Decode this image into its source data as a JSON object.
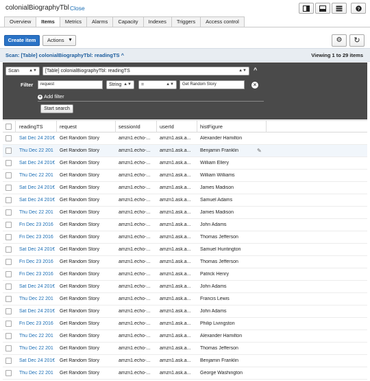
{
  "window": {
    "title": "colonialBiographyTbl",
    "close_label": "Close"
  },
  "view_buttons": [
    "panel-right-icon",
    "panel-bottom-icon",
    "panel-full-icon",
    "help-icon"
  ],
  "tabs": [
    {
      "label": "Overview",
      "active": false
    },
    {
      "label": "Items",
      "active": true
    },
    {
      "label": "Metrics",
      "active": false
    },
    {
      "label": "Alarms",
      "active": false
    },
    {
      "label": "Capacity",
      "active": false
    },
    {
      "label": "Indexes",
      "active": false
    },
    {
      "label": "Triggers",
      "active": false
    },
    {
      "label": "Access control",
      "active": false
    }
  ],
  "toolbar": {
    "create_label": "Create item",
    "actions_label": "Actions",
    "gear_icon": "gear-icon",
    "refresh_icon": "refresh-icon"
  },
  "scan": {
    "label": "Scan: [Table] colonialBiographyTbl: readingTS ^",
    "viewing": "Viewing 1 to 29 items"
  },
  "filter_panel": {
    "mode": "Scan",
    "target": "[Table] colonialBiographyTbl: readingTS",
    "filter_label": "Filter",
    "attribute": "request",
    "type": "String",
    "operator": "=",
    "value": "Get Random Story",
    "add_filter_label": "Add filter",
    "start_search_label": "Start search"
  },
  "table": {
    "columns": [
      "readingTS",
      "request",
      "sessionId",
      "userId",
      "histFigure"
    ],
    "rows": [
      [
        "Sat Dec 24 201€",
        "Get Random Story",
        "amzn1.echo-...",
        "amzn1.ask.a...",
        "Alexander Hamilton"
      ],
      [
        "Thu Dec 22 201",
        "Get Random Story",
        "amzn1.echo-...",
        "amzn1.ask.a...",
        "Benjamin Franklin"
      ],
      [
        "Sat Dec 24 201€",
        "Get Random Story",
        "amzn1.echo-...",
        "amzn1.ask.a...",
        "William Ellery"
      ],
      [
        "Thu Dec 22 201",
        "Get Random Story",
        "amzn1.echo-...",
        "amzn1.ask.a...",
        "William Williams"
      ],
      [
        "Sat Dec 24 201€",
        "Get Random Story",
        "amzn1.echo-...",
        "amzn1.ask.a...",
        "James Madison"
      ],
      [
        "Sat Dec 24 201€",
        "Get Random Story",
        "amzn1.echo-...",
        "amzn1.ask.a...",
        "Samuel Adams"
      ],
      [
        "Thu Dec 22 201",
        "Get Random Story",
        "amzn1.echo-...",
        "amzn1.ask.a...",
        "James Madison"
      ],
      [
        "Fri Dec 23 2016",
        "Get Random Story",
        "amzn1.echo-...",
        "amzn1.ask.a...",
        "John Adams"
      ],
      [
        "Fri Dec 23 2016",
        "Get Random Story",
        "amzn1.echo-...",
        "amzn1.ask.a...",
        "Thomas Jefferson"
      ],
      [
        "Sat Dec 24 201€",
        "Get Random Story",
        "amzn1.echo-...",
        "amzn1.ask.a...",
        "Samuel Huntington"
      ],
      [
        "Fri Dec 23 2016",
        "Get Random Story",
        "amzn1.echo-...",
        "amzn1.ask.a...",
        "Thomas Jefferson"
      ],
      [
        "Fri Dec 23 2016",
        "Get Random Story",
        "amzn1.echo-...",
        "amzn1.ask.a...",
        "Patrick Henry"
      ],
      [
        "Sat Dec 24 201€",
        "Get Random Story",
        "amzn1.echo-...",
        "amzn1.ask.a...",
        "John Adams"
      ],
      [
        "Thu Dec 22 201",
        "Get Random Story",
        "amzn1.echo-...",
        "amzn1.ask.a...",
        "Francis Lewis"
      ],
      [
        "Sat Dec 24 201€",
        "Get Random Story",
        "amzn1.echo-...",
        "amzn1.ask.a...",
        "John Adams"
      ],
      [
        "Fri Dec 23 2016",
        "Get Random Story",
        "amzn1.echo-...",
        "amzn1.ask.a...",
        "Philip Livingston"
      ],
      [
        "Thu Dec 22 201",
        "Get Random Story",
        "amzn1.echo-...",
        "amzn1.ask.a...",
        "Alexander Hamilton"
      ],
      [
        "Thu Dec 22 201",
        "Get Random Story",
        "amzn1.echo-...",
        "amzn1.ask.a...",
        "Thomas Jefferson"
      ],
      [
        "Sat Dec 24 201€",
        "Get Random Story",
        "amzn1.echo-...",
        "amzn1.ask.a...",
        "Benjamin Franklin"
      ],
      [
        "Thu Dec 22 201",
        "Get Random Story",
        "amzn1.echo-...",
        "amzn1.ask.a...",
        "George Washington"
      ]
    ],
    "highlighted_row": 1
  },
  "colors": {
    "accent": "#2a73c6",
    "link": "#1a6db4",
    "panel": "#4a4a4a"
  }
}
